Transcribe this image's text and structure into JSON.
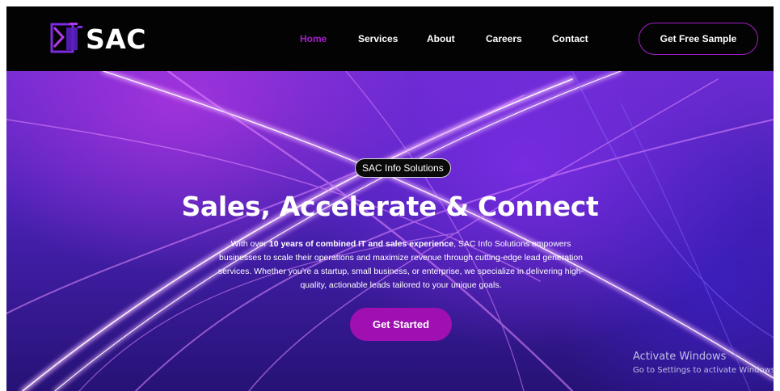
{
  "brand": {
    "name": "SAC",
    "accent_color": "#a51fc9",
    "logo_icon": "sac-logo-mark-icon"
  },
  "nav": {
    "items": [
      {
        "label": "Home",
        "active": true
      },
      {
        "label": "Services",
        "active": false
      },
      {
        "label": "About",
        "active": false
      },
      {
        "label": "Careers",
        "active": false
      },
      {
        "label": "Contact",
        "active": false
      }
    ],
    "cta_label": "Get Free Sample"
  },
  "hero": {
    "badge": "SAC Info Solutions",
    "headline": "Sales, Accelerate & Connect",
    "description_intro": "With over ",
    "description_bold": "10 years of combined IT and sales experience",
    "description_rest": ", SAC Info Solutions empowers businesses to scale their operations and maximize revenue through cutting-edge lead generation services. Whether you’re a startup, small business, or enterprise, we specialize in delivering high-quality, actionable leads tailored to your unique goals.",
    "cta_label": "Get Started",
    "cta_color": "#a00fb2"
  },
  "watermark": {
    "title": "Activate Windows",
    "subtitle": "Go to Settings to activate Windows."
  }
}
